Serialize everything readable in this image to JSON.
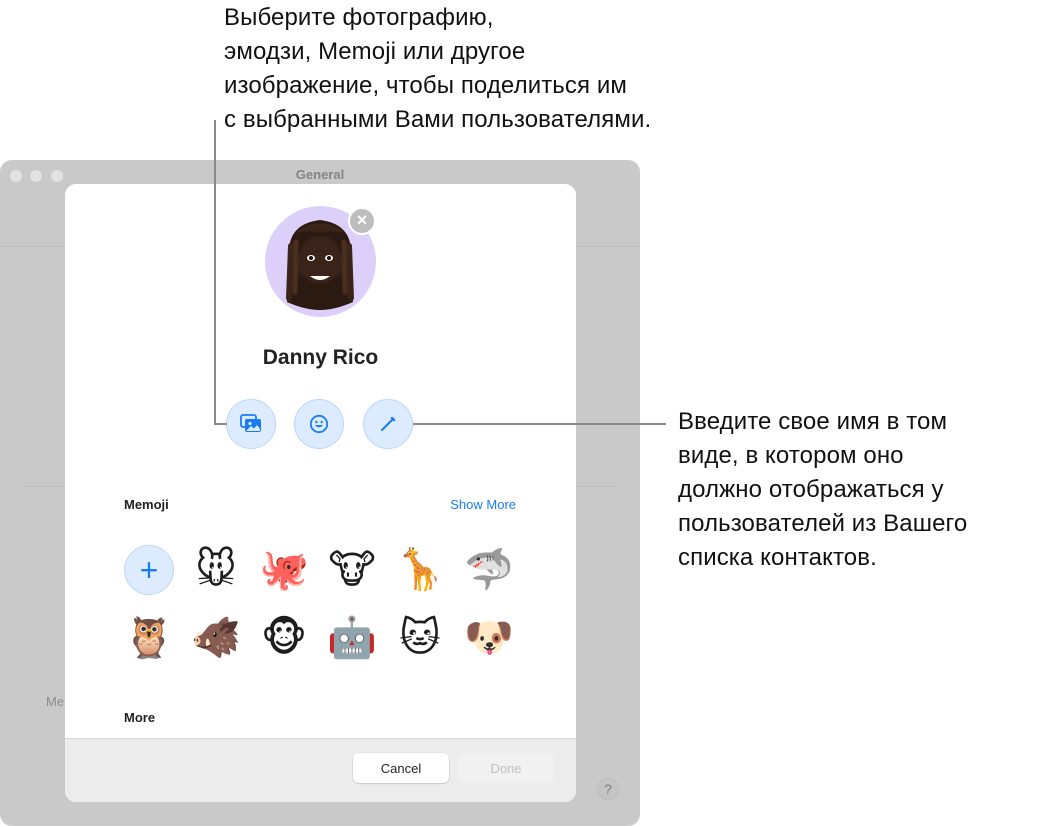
{
  "callouts": {
    "top": "Выберите фотографию,\nэмодзи, Memoji или другое\nизображение, чтобы поделиться им\nс выбранными Вами пользователями.",
    "right": "Введите свое имя в том\nвиде, в котором оно\nдолжно отображаться у\nпользователей из Вашего\nсписка контактов."
  },
  "window": {
    "title": "General",
    "partial_label": "Me",
    "help_label": "?"
  },
  "sheet": {
    "avatar_icon": "memoji-avatar",
    "remove_label": "×",
    "user_name": "Danny Rico",
    "actions": [
      {
        "name": "photos",
        "icon": "photo-gallery-icon"
      },
      {
        "name": "emoji",
        "icon": "smiley-icon"
      },
      {
        "name": "edit-name",
        "icon": "pencil-icon"
      }
    ],
    "memoji_section": {
      "label": "Memoji",
      "show_more": "Show More",
      "add_label": "+",
      "items": [
        {
          "name": "mouse",
          "glyph": "🐭"
        },
        {
          "name": "octopus",
          "glyph": "🐙"
        },
        {
          "name": "cow",
          "glyph": "🐮"
        },
        {
          "name": "giraffe",
          "glyph": "🦒"
        },
        {
          "name": "shark",
          "glyph": "🦈"
        },
        {
          "name": "owl",
          "glyph": "🦉"
        },
        {
          "name": "boar",
          "glyph": "🐗"
        },
        {
          "name": "monkey",
          "glyph": "🐵"
        },
        {
          "name": "robot",
          "glyph": "🤖"
        },
        {
          "name": "cat",
          "glyph": "🐱"
        },
        {
          "name": "dog",
          "glyph": "🐶"
        }
      ]
    },
    "more_section": {
      "label": "More"
    },
    "footer": {
      "cancel": "Cancel",
      "done": "Done"
    }
  },
  "colors": {
    "accent": "#1a7cf5",
    "button_fill": "#dcebfe",
    "avatar_bg": "#dcd0fb"
  }
}
